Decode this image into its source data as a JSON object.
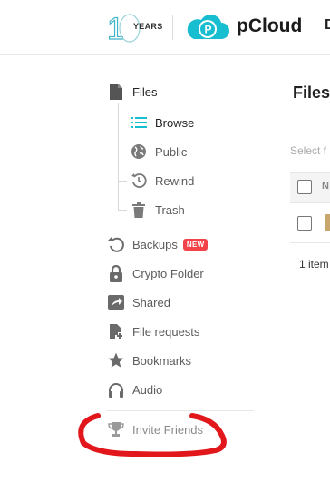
{
  "header": {
    "years_label": "YEARS",
    "brand_name": "pCloud",
    "cut_text": "D",
    "years_logo_color": "#3fb6c9",
    "brand_color": "#17bed0"
  },
  "sidebar": {
    "files": "Files",
    "browse": "Browse",
    "public": "Public",
    "rewind": "Rewind",
    "trash": "Trash",
    "backups": "Backups",
    "backups_badge": "NEW",
    "crypto": "Crypto Folder",
    "shared": "Shared",
    "file_requests": "File requests",
    "bookmarks": "Bookmarks",
    "audio": "Audio",
    "invite": "Invite Friends",
    "accent_color": "#17bed0",
    "badge_color": "#f2434a"
  },
  "main": {
    "title": "Files",
    "filter_placeholder": "Select f",
    "column_name": "N",
    "item_count": "1 item"
  },
  "annotation": {
    "color": "#e2171c"
  }
}
